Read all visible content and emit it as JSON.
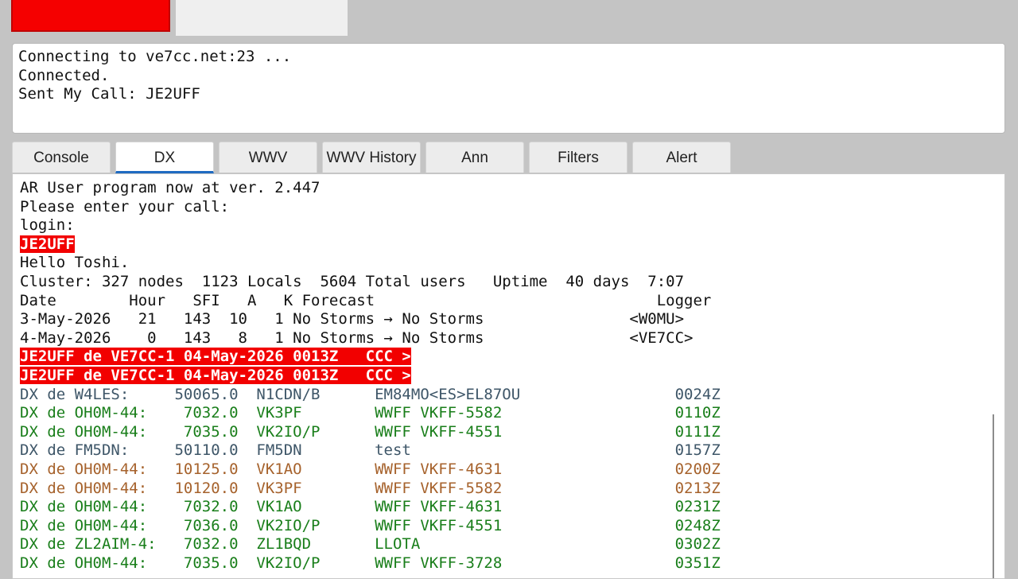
{
  "top_log": {
    "lines": [
      "Connecting to ve7cc.net:23 ...",
      "Connected.",
      "Sent My Call: JE2UFF"
    ]
  },
  "tabs": [
    {
      "label": "Console"
    },
    {
      "label": "DX",
      "active": true
    },
    {
      "label": "WWV"
    },
    {
      "label": "WWV History"
    },
    {
      "label": "Ann"
    },
    {
      "label": "Filters"
    },
    {
      "label": "Alert"
    }
  ],
  "console": {
    "lines": [
      "AR User program now at ver. 2.447",
      "Please enter your call:",
      "login:",
      "JE2UFF",
      "Hello Toshi.",
      "Cluster: 327 nodes  1123 Locals  5604 Total users   Uptime  40 days  7:07",
      "Date        Hour   SFI   A   K Forecast                               Logger",
      "3-May-2026   21   143  10   1 No Storms → No Storms                <W0MU>",
      "4-May-2026    0   143   8   1 No Storms → No Storms                <VE7CC>",
      "JE2UFF de VE7CC-1 04-May-2026 0013Z   CCC >",
      "JE2UFF de VE7CC-1 04-May-2026 0013Z   CCC >",
      "DX de W4LES:     50065.0  N1CDN/B      EM84MO<ES>EL87OU                 0024Z",
      "DX de OH0M-44:    7032.0  VK3PF        WWFF VKFF-5582                   0110Z",
      "DX de OH0M-44:    7035.0  VK2IO/P      WWFF VKFF-4551                   0111Z",
      "DX de FM5DN:     50110.0  FM5DN        test                             0157Z",
      "DX de OH0M-44:   10125.0  VK1AO        WWFF VKFF-4631                   0200Z",
      "DX de OH0M-44:   10120.0  VK3PF        WWFF VKFF-5582                   0213Z",
      "DX de OH0M-44:    7032.0  VK1AO        WWFF VKFF-4631                   0231Z",
      "DX de OH0M-44:    7036.0  VK2IO/P      WWFF VKFF-4551                   0248Z",
      "DX de ZL2AIM-4:   7032.0  ZL1BQD       LLOTA                            0302Z",
      "DX de OH0M-44:    7035.0  VK2IO/P      WWFF VKFF-3728                   0351Z"
    ]
  },
  "colors": {
    "highlight_red": "#f20000",
    "dx_slate": "#3e5668",
    "dx_green": "#197e1a",
    "dx_brown": "#a6622c",
    "tab_active_underline": "#1f6bc1"
  }
}
